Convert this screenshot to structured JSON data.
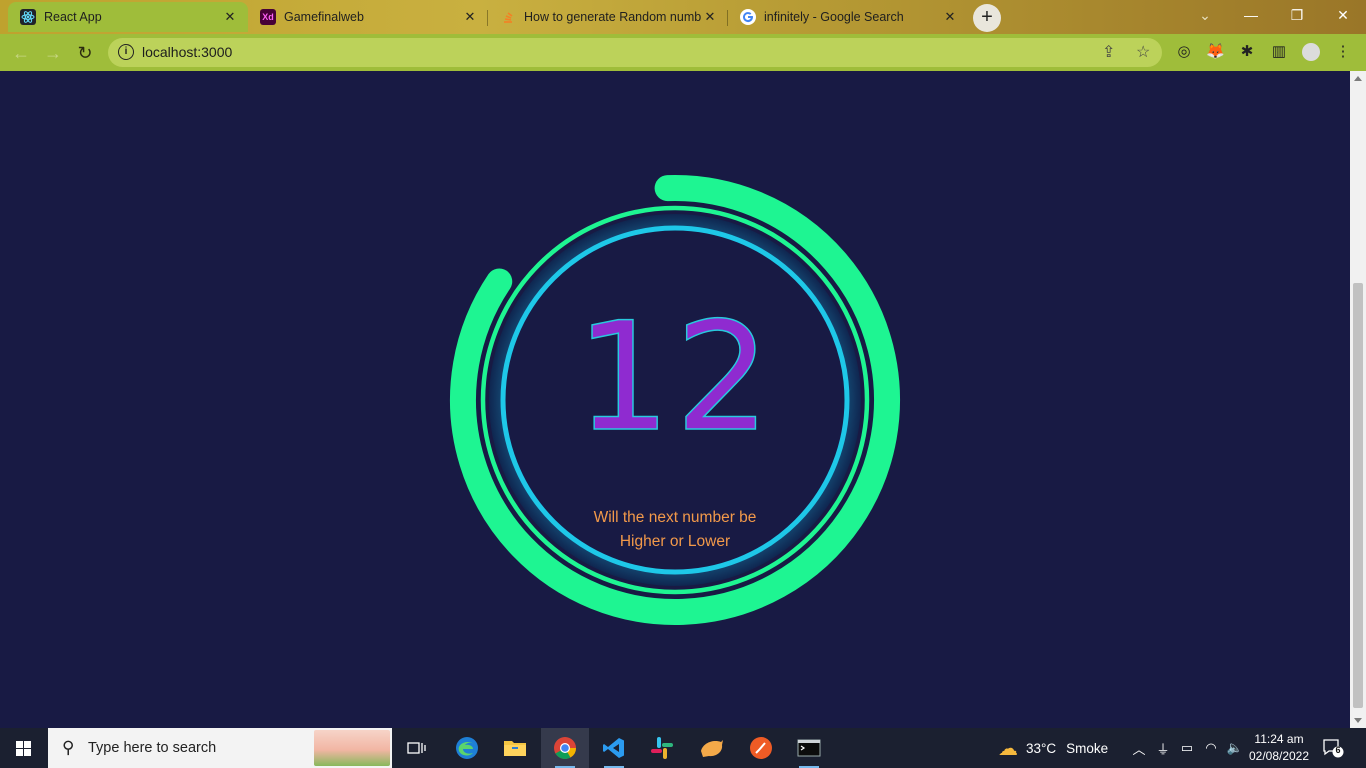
{
  "browser": {
    "tabs": [
      {
        "title": "React App",
        "icon": "react-icon",
        "active": true
      },
      {
        "title": "Gamefinalweb",
        "icon": "xd-icon",
        "icon_text": "Xd",
        "active": false
      },
      {
        "title": "How to generate Random numb",
        "icon": "stack-icon",
        "active": false
      },
      {
        "title": "infinitely - Google Search",
        "icon": "google-icon",
        "active": false
      }
    ],
    "new_tab": "+",
    "address": "localhost:3000"
  },
  "game": {
    "number": "12",
    "prompt_line1": "Will the next number be",
    "prompt_line2": "Higher or Lower",
    "progress_fraction": 0.85,
    "colors": {
      "background": "#181a44",
      "outer_ring": "#1ef592",
      "inner_ring": "#1ec8e8",
      "number_fill": "#8f2bd0",
      "prompt": "#f2994a"
    }
  },
  "taskbar": {
    "search_placeholder": "Type here to search",
    "weather_temp": "33°C",
    "weather_text": "Smoke",
    "time": "11:24 am",
    "date": "02/08/2022",
    "notification_count": "6"
  }
}
